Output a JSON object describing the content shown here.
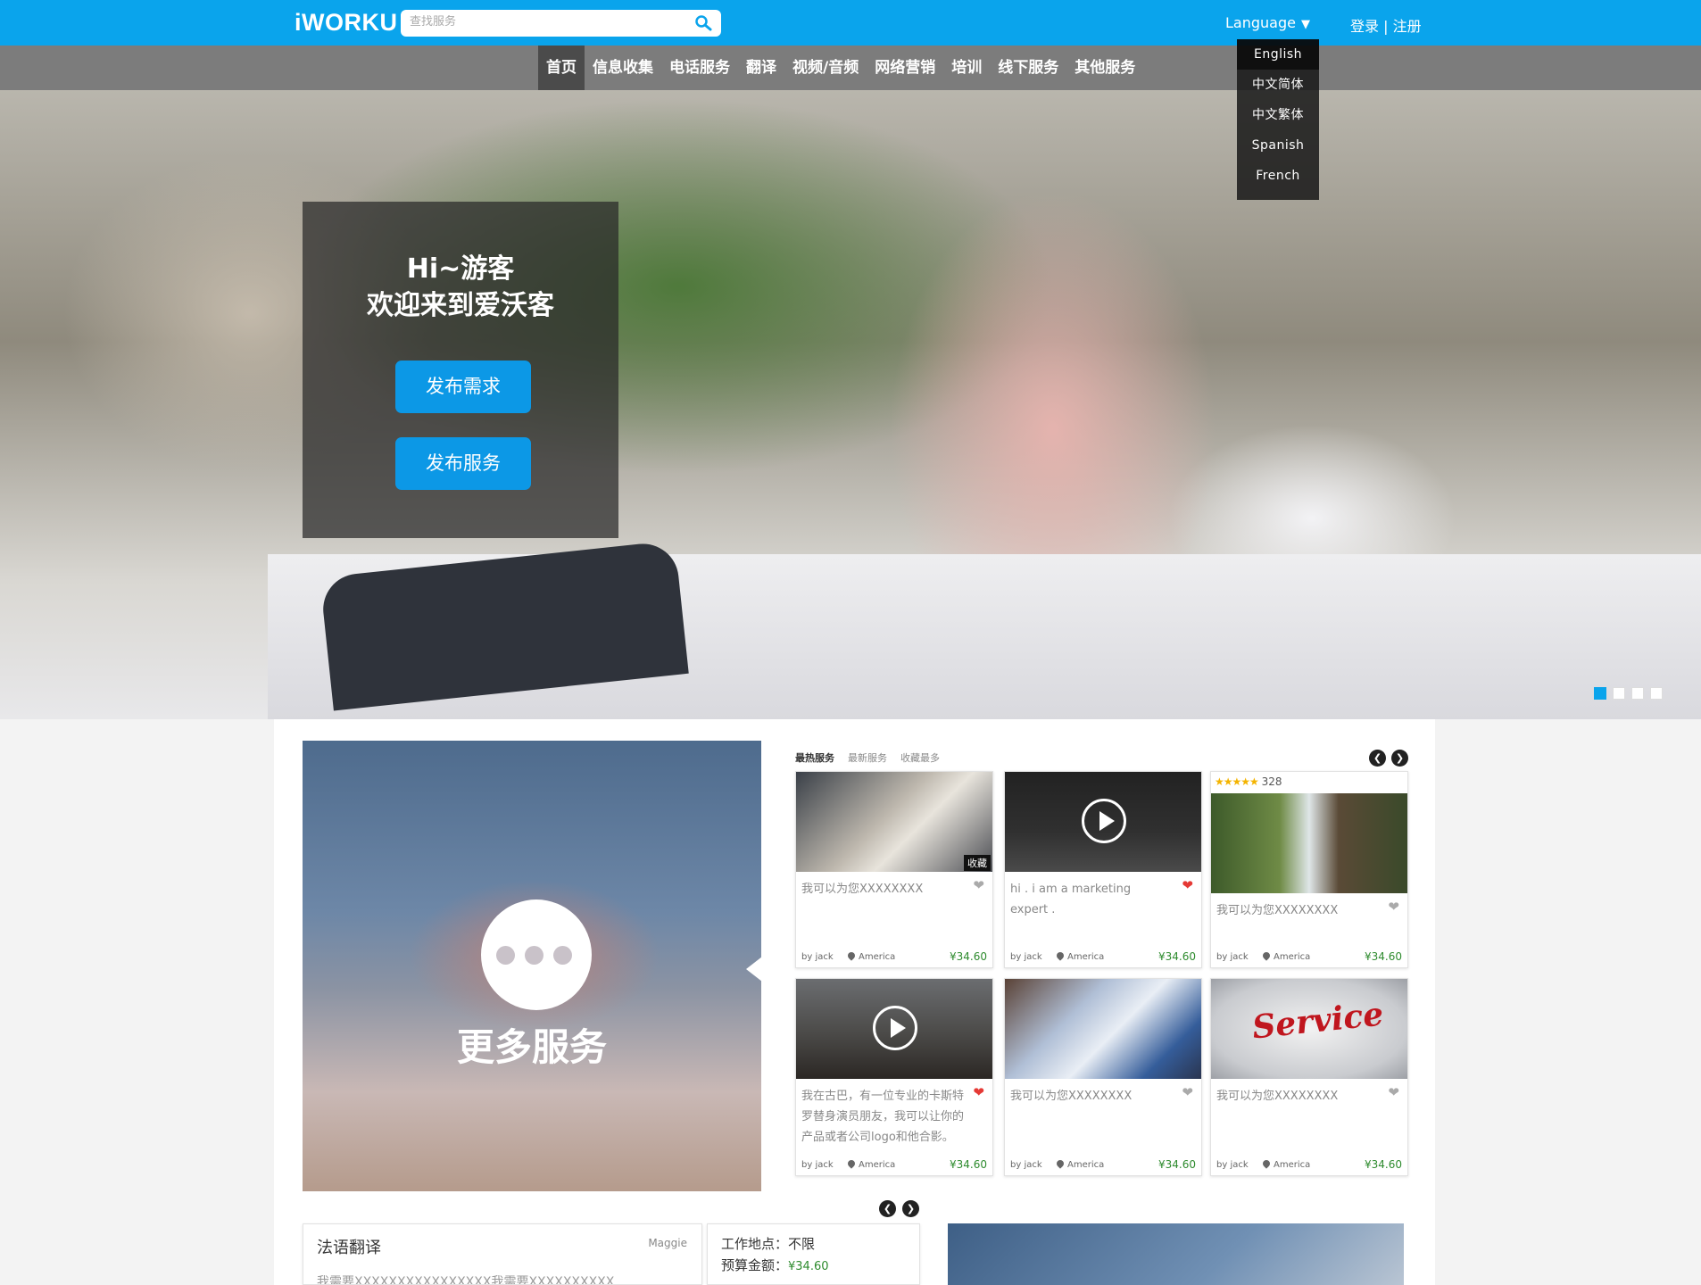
{
  "header": {
    "logo": "iWORKU",
    "search_placeholder": "查找服务",
    "language_label": "Language",
    "language_caret": "▼",
    "login": "登录",
    "separator": "|",
    "register": "注册"
  },
  "nav": [
    "首页",
    "信息收集",
    "电话服务",
    "翻译",
    "视频/音频",
    "网络营销",
    "培训",
    "线下服务",
    "其他服务"
  ],
  "language_menu": [
    "English",
    "中文简体",
    "中文繁体",
    "Spanish",
    "French"
  ],
  "hero": {
    "line1": "Hi~游客",
    "line2": "欢迎来到爱沃客",
    "post_demand": "发布需求",
    "post_service": "发布服务"
  },
  "more_services_label": "更多服务",
  "tabs": [
    "最热服务",
    "最新服务",
    "收藏最多"
  ],
  "services": [
    {
      "title": "我可以为您XXXXXXXX",
      "by": "by jack",
      "location": "America",
      "price": "¥34.60"
    },
    {
      "title": "hi . i am a marketing expert .",
      "by": "by jack",
      "location": "America",
      "price": "¥34.60"
    },
    {
      "title": "我可以为您XXXXXXXX",
      "rating_count": "328",
      "by": "by jack",
      "location": "America",
      "price": "¥34.60"
    },
    {
      "title": "我在古巴，有一位专业的卡斯特罗替身演员朋友，我可以让你的产品或者公司logo和他合影。",
      "by": "by jack",
      "location": "America",
      "price": "¥34.60"
    },
    {
      "title": "我可以为您XXXXXXXX",
      "by": "by jack",
      "location": "America",
      "price": "¥34.60"
    },
    {
      "title": "我可以为您XXXXXXXX",
      "image_text": "Service",
      "by": "by jack",
      "location": "America",
      "price": "¥34.60"
    }
  ],
  "collect_tag": "收藏",
  "request": {
    "title": "法语翻译",
    "user": "Maggie",
    "desc": "我需要XXXXXXXXXXXXXXXX我需要XXXXXXXXXX",
    "location_label": "工作地点：不限",
    "budget_label": "预算金额：",
    "budget_value": "¥34.60"
  },
  "colors": {
    "brand": "#0aa4ec",
    "price": "#2e8b2e",
    "favorite": "#e53935",
    "rating": "#f4b400"
  }
}
